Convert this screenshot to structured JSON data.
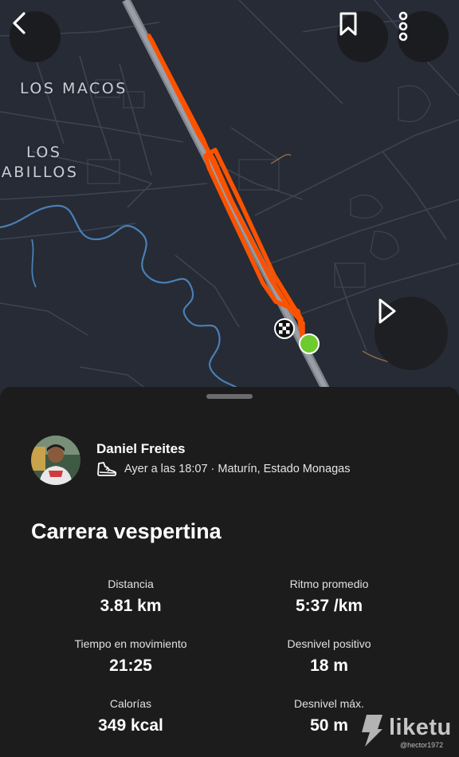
{
  "map": {
    "places": [
      "LOS MACOS",
      "LOS",
      "JABILLOS"
    ],
    "colors": {
      "background": "#262b35",
      "route": "#fc5200",
      "finish": "#6ecb2f"
    }
  },
  "header": {
    "back_icon": "chevron-left-icon",
    "bookmark_icon": "bookmark-icon",
    "more_icon": "more-vertical-icon"
  },
  "play_icon": "play-icon",
  "athlete": {
    "name": "Daniel Freites",
    "activity_icon": "shoe-icon",
    "meta": "Ayer a las 18:07 · Maturín, Estado Monagas"
  },
  "activity": {
    "title": "Carrera vespertina",
    "stats": [
      {
        "label": "Distancia",
        "value": "3.81 km"
      },
      {
        "label": "Ritmo promedio",
        "value": "5:37 /km"
      },
      {
        "label": "Tiempo en movimiento",
        "value": "21:25"
      },
      {
        "label": "Desnivel positivo",
        "value": "18 m"
      },
      {
        "label": "Calorías",
        "value": "349 kcal"
      },
      {
        "label": "Desnivel máx.",
        "value": "50 m"
      }
    ]
  },
  "watermark": {
    "brand": "liketu",
    "handle": "@hector1972"
  }
}
